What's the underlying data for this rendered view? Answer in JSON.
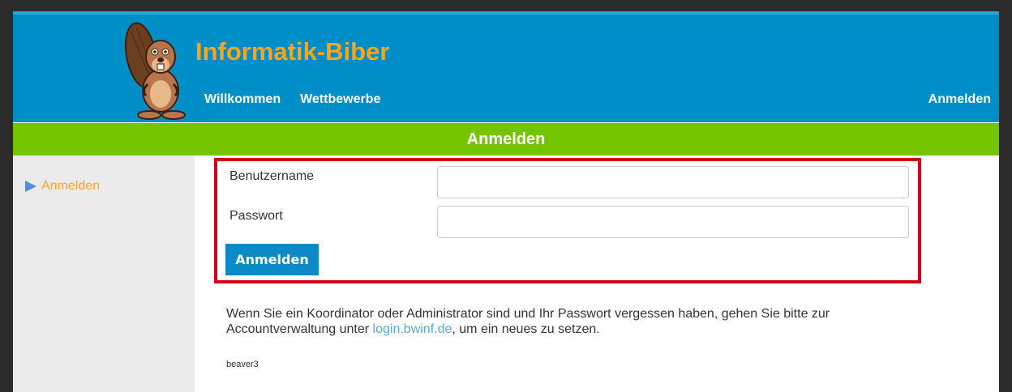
{
  "header": {
    "site_title": "Informatik-Biber",
    "nav": [
      "Willkommen",
      "Wettbewerbe"
    ],
    "login_link": "Anmelden"
  },
  "page_bar": {
    "title": "Anmelden"
  },
  "sidebar": {
    "items": [
      {
        "label": "Anmelden",
        "icon": "triangle-right-icon"
      }
    ]
  },
  "login_form": {
    "username_label": "Benutzername",
    "username_value": "",
    "password_label": "Passwort",
    "password_value": "",
    "submit_label": "Anmelden"
  },
  "info": {
    "text_before": "Wenn Sie ein Koordinator oder Administrator sind und Ihr Passwort vergessen haben, gehen Sie bitte zur Accountverwaltung unter ",
    "link_text": "login.bwinf.de",
    "text_after": ", um ein neues zu setzen."
  },
  "footer_code": "beaver3",
  "colors": {
    "header_bg": "#008ec8",
    "title": "#f9a51d",
    "bar_green": "#74c400",
    "button": "#0a8ac6",
    "highlight_border": "#d0021b",
    "link": "#5aaad8"
  }
}
